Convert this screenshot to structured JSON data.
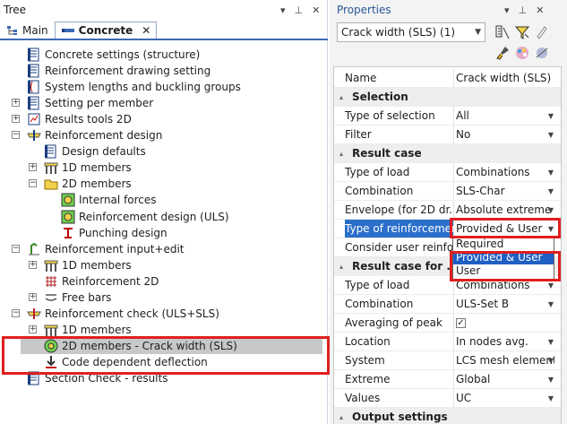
{
  "tree": {
    "title": "Tree",
    "tabs": [
      {
        "label": "Main",
        "active": false
      },
      {
        "label": "Concrete",
        "active": true,
        "close": "✕"
      }
    ],
    "items": [
      {
        "label": "Concrete settings (structure)",
        "level": 1,
        "expander": "",
        "icon": "concrete-settings-icon"
      },
      {
        "label": "Reinforcement drawing setting",
        "level": 1,
        "expander": "",
        "icon": "drawing-setting-icon"
      },
      {
        "label": "System lengths and buckling groups",
        "level": 1,
        "expander": "",
        "icon": "buckling-icon"
      },
      {
        "label": "Setting per member",
        "level": 1,
        "expander": "+",
        "icon": "member-setting-icon"
      },
      {
        "label": "Results tools 2D",
        "level": 1,
        "expander": "+",
        "icon": "results-tools-icon"
      },
      {
        "label": "Reinforcement design",
        "level": 1,
        "expander": "−",
        "icon": "reinforcement-design-icon"
      },
      {
        "label": "Design defaults",
        "level": 2,
        "expander": "",
        "icon": "design-defaults-icon"
      },
      {
        "label": "1D members",
        "level": 2,
        "expander": "+",
        "icon": "members-1d-icon"
      },
      {
        "label": "2D members",
        "level": 2,
        "expander": "−",
        "icon": "members-2d-folder-icon"
      },
      {
        "label": "Internal forces",
        "level": 3,
        "expander": "",
        "icon": "internal-forces-icon"
      },
      {
        "label": "Reinforcement design (ULS)",
        "level": 3,
        "expander": "",
        "icon": "design-uls-icon"
      },
      {
        "label": "Punching design",
        "level": 3,
        "expander": "",
        "icon": "punching-icon"
      },
      {
        "label": "Reinforcement input+edit",
        "level": 1,
        "expander": "−",
        "icon": "input-edit-icon"
      },
      {
        "label": "1D members",
        "level": 2,
        "expander": "+",
        "icon": "members-1d-icon"
      },
      {
        "label": "Reinforcement 2D",
        "level": 2,
        "expander": "",
        "icon": "reinforcement-2d-icon"
      },
      {
        "label": "Free bars",
        "level": 2,
        "expander": "+",
        "icon": "free-bars-icon"
      },
      {
        "label": "Reinforcement check (ULS+SLS)",
        "level": 1,
        "expander": "−",
        "icon": "reinforcement-check-icon"
      },
      {
        "label": "1D members",
        "level": 2,
        "expander": "+",
        "icon": "members-1d-icon"
      },
      {
        "label": "2D members - Crack width (SLS)",
        "level": 2,
        "expander": "",
        "icon": "crack-width-icon",
        "selected": true
      },
      {
        "label": "Code dependent deflection",
        "level": 2,
        "expander": "",
        "icon": "deflection-icon"
      },
      {
        "label": "Section Check - results",
        "level": 1,
        "expander": "",
        "icon": "section-check-icon"
      }
    ]
  },
  "properties": {
    "title": "Properties",
    "combo_value": "Crack width (SLS) (1)",
    "rows": [
      {
        "type": "prop",
        "name": "Name",
        "value": "Crack width (SLS)",
        "arrow": false
      },
      {
        "type": "section",
        "name": "Selection"
      },
      {
        "type": "prop",
        "name": "Type of selection",
        "value": "All",
        "arrow": true
      },
      {
        "type": "prop",
        "name": "Filter",
        "value": "No",
        "arrow": true
      },
      {
        "type": "section",
        "name": "Result case"
      },
      {
        "type": "prop",
        "name": "Type of load",
        "value": "Combinations",
        "arrow": true
      },
      {
        "type": "prop",
        "name": "Combination",
        "value": "SLS-Char",
        "arrow": true
      },
      {
        "type": "prop",
        "name": "Envelope (for 2D dr...",
        "value": "Absolute extreme",
        "arrow": true
      },
      {
        "type": "prop",
        "name": "Type of reinforcement",
        "value": "Provided & User",
        "arrow": true,
        "highlight": true
      },
      {
        "type": "prop",
        "name": "Consider user reinfo...",
        "value": "",
        "arrow": false
      },
      {
        "type": "section",
        "name": "Result case for ..."
      },
      {
        "type": "prop",
        "name": "Type of load",
        "value": "Combinations",
        "arrow": true
      },
      {
        "type": "prop",
        "name": "Combination",
        "value": "ULS-Set B",
        "arrow": true
      },
      {
        "type": "prop",
        "name": "Averaging of peak",
        "value": "",
        "checkbox": "✓",
        "arrow": false
      },
      {
        "type": "prop",
        "name": "Location",
        "value": "In nodes avg.",
        "arrow": true
      },
      {
        "type": "prop",
        "name": "System",
        "value": "LCS mesh element",
        "arrow": true
      },
      {
        "type": "prop",
        "name": "Extreme",
        "value": "Global",
        "arrow": true
      },
      {
        "type": "prop",
        "name": "Values",
        "value": "UC",
        "arrow": true
      },
      {
        "type": "section",
        "name": "Output settings"
      }
    ],
    "dropdown": {
      "options": [
        "Required",
        "Provided & User",
        "User"
      ],
      "selected": "Provided & User"
    }
  },
  "colors": {
    "accent": "#2b6fcb",
    "highlight_box": "#e01f1f",
    "title_blue": "#2b5797"
  }
}
